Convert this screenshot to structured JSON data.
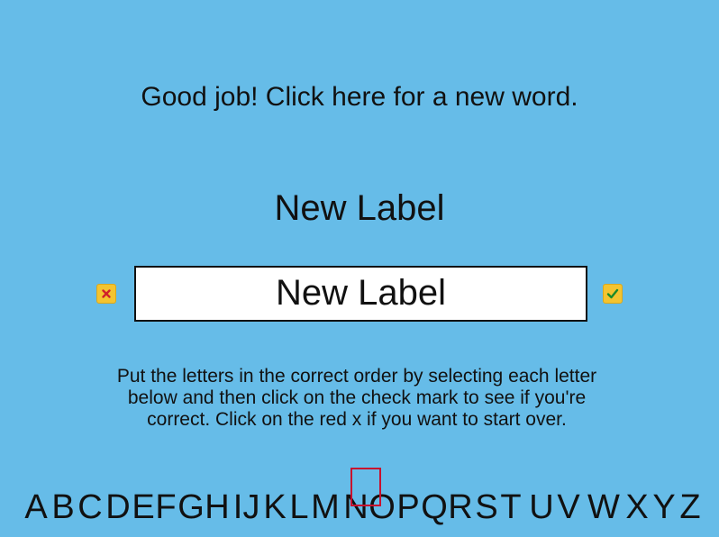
{
  "prompt": {
    "new_word_text": "Good job! Click here for a new word."
  },
  "word": {
    "heading": "New Label",
    "answer": "New Label"
  },
  "buttons": {
    "reset_icon": "red-x-icon",
    "check_icon": "green-check-icon"
  },
  "instructions": {
    "text": "Put the letters in the correct order by selecting each letter below and then click on the check mark to see if you're correct. Click on the red x if you want to start over."
  },
  "letters": [
    "A",
    "B",
    "C",
    "D",
    "E",
    "F",
    "G",
    "H",
    "I",
    "J",
    "K",
    "L",
    "M",
    "N",
    "O",
    "P",
    "Q",
    "R",
    "S",
    "T",
    "U",
    "V",
    "W",
    "X",
    "Y",
    "Z"
  ],
  "colors": {
    "background": "#66bce8",
    "button_fill": "#f4c430",
    "reset_mark": "#d0202a",
    "check_mark": "#1a8a2a",
    "selection_outline": "#c8102e"
  }
}
